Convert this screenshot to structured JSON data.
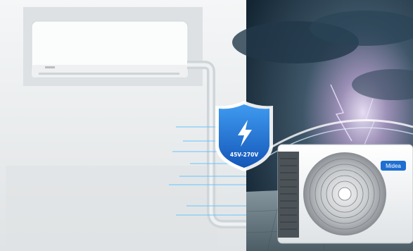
{
  "scene": {
    "description_free": true,
    "badge": {
      "voltage_range": "45V-270V",
      "icon": "lightning-bolt-icon",
      "color": "#1e6fd1"
    },
    "outdoor_unit": {
      "brand": "Midea"
    },
    "colors": {
      "wall": "#e9ecee",
      "sky_dark": "#1d3344",
      "storm_glow": "#c9b7e6",
      "protection_lines": "#5fc4ff"
    }
  }
}
